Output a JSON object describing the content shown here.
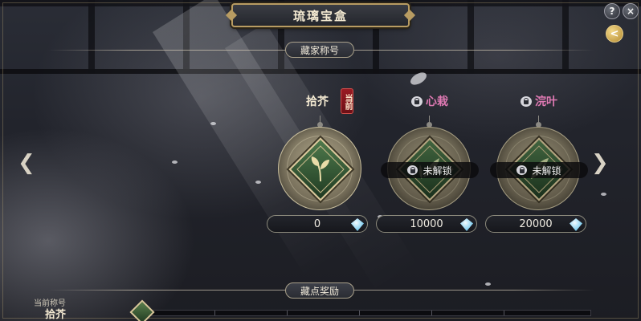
{
  "window": {
    "title": "琉璃宝盒"
  },
  "top_buttons": {
    "help": "?",
    "close": "×",
    "back": "<"
  },
  "sections": {
    "titles_header": "藏家称号",
    "rewards_header": "藏点奖励"
  },
  "nav": {
    "prev": "❮",
    "next": "❯"
  },
  "cards": [
    {
      "name": "拾芥",
      "state": "current",
      "badge": "当前",
      "points": "0"
    },
    {
      "name": "心栽",
      "state": "locked",
      "locked_label": "未解锁",
      "points": "10000"
    },
    {
      "name": "浣叶",
      "state": "locked",
      "locked_label": "未解锁",
      "points": "20000"
    }
  ],
  "current_title": {
    "label": "当前称号",
    "value": "拾芥"
  },
  "progress": {
    "fraction": 0.0
  }
}
